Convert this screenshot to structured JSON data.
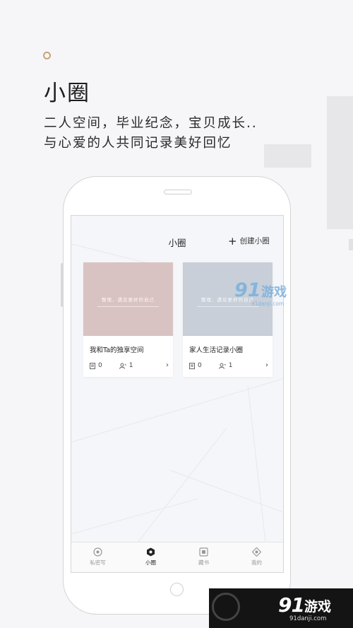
{
  "promo": {
    "title": "小圈",
    "line1": "二人空间，毕业纪念，宝贝成长..",
    "line2": "与心爱的人共同记录美好回忆"
  },
  "app": {
    "header_title": "小圈",
    "create_label": "创建小圈"
  },
  "cards": [
    {
      "title": "我和Ta的独享空间",
      "cover_text": "整理、遇见更好的自己",
      "posts": "0",
      "members": "1",
      "color": "#d9c3c2"
    },
    {
      "title": "家人生活记录小圈",
      "cover_text": "整理、遇见更好的自己",
      "posts": "0",
      "members": "1",
      "color": "#c8cfd8"
    }
  ],
  "tabs": [
    {
      "label": "私密写",
      "icon": "target-icon"
    },
    {
      "label": "小圈",
      "icon": "hexagon-icon",
      "active": true
    },
    {
      "label": "藏书",
      "icon": "book-square-icon"
    },
    {
      "label": "我的",
      "icon": "diamond-icon"
    }
  ],
  "watermark": {
    "brand_num": "91",
    "brand_name": "游戏",
    "url": "91danji.com"
  }
}
